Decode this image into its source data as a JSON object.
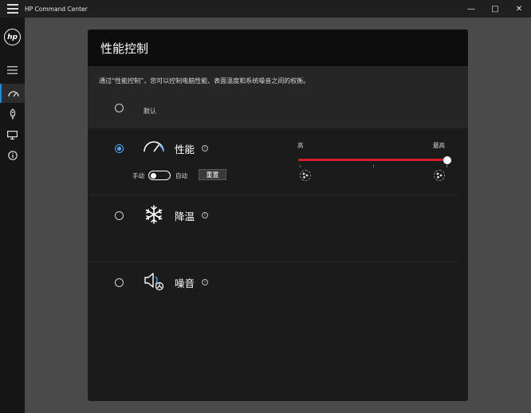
{
  "window": {
    "title": "HP Command Center",
    "minimize": "—",
    "maximize": "□",
    "close": "✕"
  },
  "sidebar": {
    "logo": "hp",
    "items": [
      {
        "name": "menu-icon"
      },
      {
        "name": "gauge-icon",
        "active": true
      },
      {
        "name": "rocket-icon"
      },
      {
        "name": "monitor-icon"
      },
      {
        "name": "info-icon"
      }
    ]
  },
  "panel": {
    "title": "性能控制",
    "description": "通过“性能控制”，您可以控制电脑性能、表面温度和系统噪音之间的权衡。",
    "options": {
      "default": {
        "label": "默认",
        "checked": false
      },
      "performance": {
        "label": "性能",
        "checked": true,
        "manual_label": "手动",
        "auto_label": "自动",
        "reset_label": "重置",
        "slider": {
          "low_label": "高",
          "high_label": "最高",
          "value_fraction": 1.0
        }
      },
      "cool": {
        "label": "降温",
        "checked": false
      },
      "quiet": {
        "label": "噪音",
        "checked": false
      }
    },
    "info_glyph": "i"
  },
  "colors": {
    "accent": "#1b8ae6",
    "radio_selected": "#4aa3f0",
    "slider": "#d11f2e"
  }
}
